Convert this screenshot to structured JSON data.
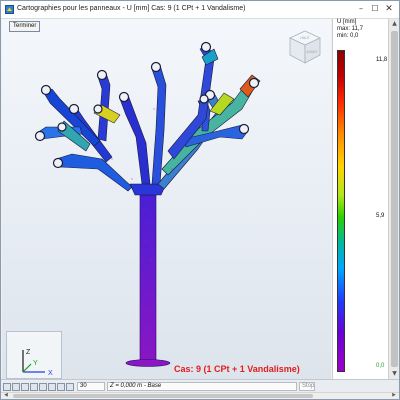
{
  "window": {
    "title": "Cartographies pour les panneaux - U [mm] Cas: 9 (1 CPt + 1 Vandalisme)",
    "icons": {
      "app": "app-icon",
      "minimize": "minimize-icon",
      "maximize": "maximize-icon",
      "close": "close-icon"
    },
    "minimize_glyph": "–",
    "maximize_glyph": "☐",
    "close_glyph": "✕"
  },
  "toolbar": {
    "finish_label": "Terminer"
  },
  "viewport": {
    "case_label": "Cas: 9 (1 CPt + 1 Vandalisme)",
    "case_color": "#e21d1d",
    "triad_labels": {
      "x": "X",
      "y": "Y",
      "z": "Z"
    },
    "view_cube_icon": "view-cube-icon",
    "view_cube_faces": {
      "top": "HAUT",
      "front": "AVANT"
    }
  },
  "legend": {
    "unit": "U [mm]",
    "max": "max: 11,7",
    "min": "min: 0,0",
    "ticks": {
      "max": "11,8",
      "mid": "5,9",
      "min": "0,0"
    },
    "scale_colors": [
      "#8b0000",
      "#ff2a00",
      "#ffd400",
      "#2bd000",
      "#00a8ff",
      "#1e3cff",
      "#a000c8"
    ]
  },
  "scrollbar": {
    "up_glyph": "▲",
    "down_glyph": "▼"
  },
  "statusbar": {
    "number_field": "30",
    "z_field": "Z = 0,000 m - Base",
    "stop_label": "Stop",
    "hscroll_left_glyph": "◀",
    "hscroll_right_glyph": "▶"
  }
}
